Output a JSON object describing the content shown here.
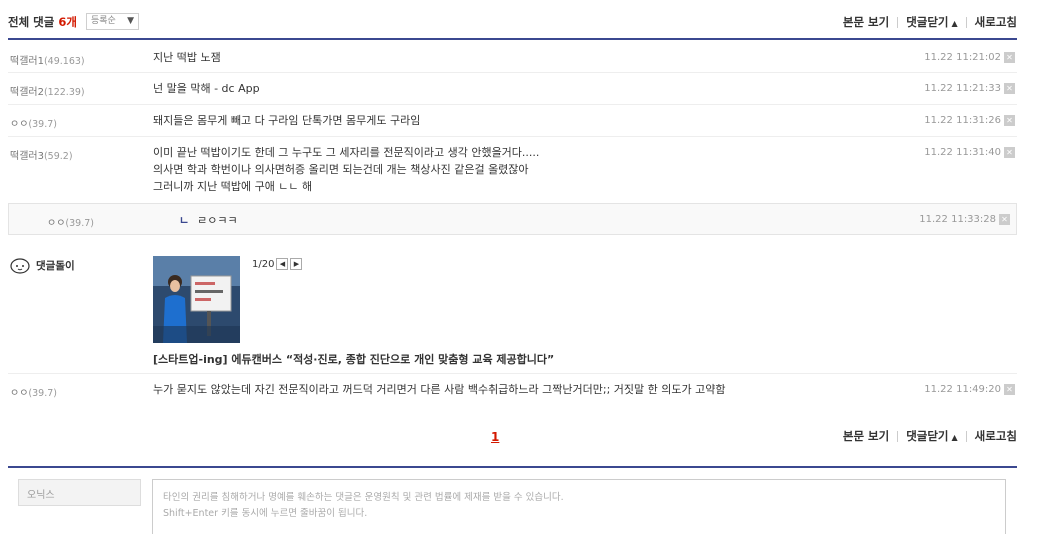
{
  "header": {
    "title_prefix": "전체 댓글 ",
    "count": "6개",
    "sort": "등록순",
    "view_post": "본문 보기",
    "close_comments": "댓글닫기",
    "refresh": "새로고침"
  },
  "comments": [
    {
      "nick": "떡갤러1",
      "ip": "(49.163)",
      "lines": [
        "지난 떡밥 노잼"
      ],
      "time": "11.22 11:21:02"
    },
    {
      "nick": "떡갤러2",
      "ip": "(122.39)",
      "lines": [
        "넌 말을 막해 - dc App"
      ],
      "time": "11.22 11:21:33"
    },
    {
      "nick": "ㅇㅇ",
      "ip": "(39.7)",
      "lines": [
        "돼지들은 몸무게 빼고 다 구라임 단톡가면 몸무게도 구라임"
      ],
      "time": "11.22 11:31:26"
    },
    {
      "nick": "떡갤러3",
      "ip": "(59.2)",
      "lines": [
        "이미 끝난 떡밥이기도 한데 그 누구도 그 세자리를 전문직이라고 생각 안했을거다.....",
        "의사면 학과 학번이나 의사면허증 올리면 되는건데 개는 책상사진 같은걸 올렸잖아",
        "그러니까 지난 떡밥에 구애 ㄴㄴ 해"
      ],
      "time": "11.22 11:31:40"
    }
  ],
  "reply": {
    "nick": "ㅇㅇ",
    "ip": "(39.7)",
    "corner": "ㄴ",
    "text": "ㄹㅇㅋㅋ",
    "time": "11.22 11:33:28"
  },
  "bot": {
    "name": "댓글돌이",
    "pager": "1/20",
    "headline": "[스타트업-ing] 에듀캔버스 “적성·진로, 종합 진단으로 개인 맞춤형 교육 제공합니다”"
  },
  "last_comment": {
    "nick": "ㅇㅇ",
    "ip": "(39.7)",
    "text": "누가 묻지도 않았는데 자긴 전문직이라고 꺼드덕 거리면거 다른 사람 백수취급하느라 그짝난거더만;; 거짓말 한 의도가 고약함",
    "time": "11.22 11:49:20"
  },
  "footer": {
    "page": "1",
    "view_post": "본문 보기",
    "close_comments": "댓글닫기",
    "refresh": "새로고침"
  },
  "form": {
    "name_placeholder": "오닉스",
    "comment_line1": "타인의 권리를 침해하거나 명예를 훼손하는 댓글은 운영원칙 및 관련 법률에 제재를 받을 수 있습니다.",
    "comment_line2": "Shift+Enter 키를 동시에 누르면 줄바꿈이 됩니다."
  },
  "colors": {
    "accent": "#3b4890",
    "count": "#d31900"
  }
}
